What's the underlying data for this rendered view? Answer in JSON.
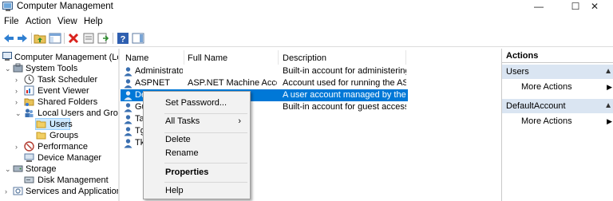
{
  "window": {
    "title": "Computer Management",
    "minimize": "—",
    "maximize": "☐",
    "close": "✕"
  },
  "menu": [
    "File",
    "Action",
    "View",
    "Help"
  ],
  "toolbar": [
    "back-arrow-icon",
    "forward-arrow-icon",
    "up-folder-icon",
    "show-hide-tree-icon",
    "delete-icon",
    "properties-icon",
    "export-list-icon",
    "help-icon",
    "action-pane-icon"
  ],
  "tree": {
    "items": [
      {
        "label": "Computer Management (Local",
        "icon": "computer-management-icon"
      },
      {
        "label": "System Tools",
        "icon": "tools-icon",
        "expander": "⌄"
      },
      {
        "label": "Task Scheduler",
        "icon": "clock-icon",
        "expander": "›"
      },
      {
        "label": "Event Viewer",
        "icon": "event-viewer-icon",
        "expander": "›"
      },
      {
        "label": "Shared Folders",
        "icon": "shared-folder-icon",
        "expander": "›"
      },
      {
        "label": "Local Users and Groups",
        "icon": "users-groups-icon",
        "expander": "⌄"
      },
      {
        "label": "Users",
        "icon": "folder-icon"
      },
      {
        "label": "Groups",
        "icon": "folder-icon"
      },
      {
        "label": "Performance",
        "icon": "performance-icon",
        "expander": "›"
      },
      {
        "label": "Device Manager",
        "icon": "device-manager-icon"
      },
      {
        "label": "Storage",
        "icon": "storage-icon",
        "expander": "⌄"
      },
      {
        "label": "Disk Management",
        "icon": "disk-icon"
      },
      {
        "label": "Services and Applications",
        "icon": "services-icon",
        "expander": "›"
      }
    ]
  },
  "list": {
    "columns": [
      "Name",
      "Full Name",
      "Description"
    ],
    "rows": [
      {
        "name": "Administrator",
        "full_name": "",
        "description": "Built-in account for administering..."
      },
      {
        "name": "ASPNET",
        "full_name": "ASP.NET Machine Acco...",
        "description": "Account used for running the AS..."
      },
      {
        "name": "DefaultA",
        "full_name": "",
        "description": "A user account managed by the s..."
      },
      {
        "name": "Gu",
        "full_name": "",
        "description": "Built-in account for guest access t..."
      },
      {
        "name": "Ta",
        "full_name": "",
        "description": ""
      },
      {
        "name": "Tg",
        "full_name": "",
        "description": ""
      },
      {
        "name": "Tk",
        "full_name": "",
        "description": ""
      }
    ]
  },
  "context_menu": {
    "set_password": "Set Password...",
    "all_tasks": "All Tasks",
    "submenu_arrow": "›",
    "delete": "Delete",
    "rename": "Rename",
    "properties": "Properties",
    "help": "Help"
  },
  "actions": {
    "title": "Actions",
    "section1": "Users",
    "more1": "More Actions",
    "section2": "DefaultAccount",
    "more2": "More Actions",
    "collapse": "▲",
    "arrow": "▶"
  },
  "colors": {
    "selection_blue": "#0078d7",
    "tree_selection": "#cce8ff",
    "actions_section_bg": "#dae5f2"
  }
}
